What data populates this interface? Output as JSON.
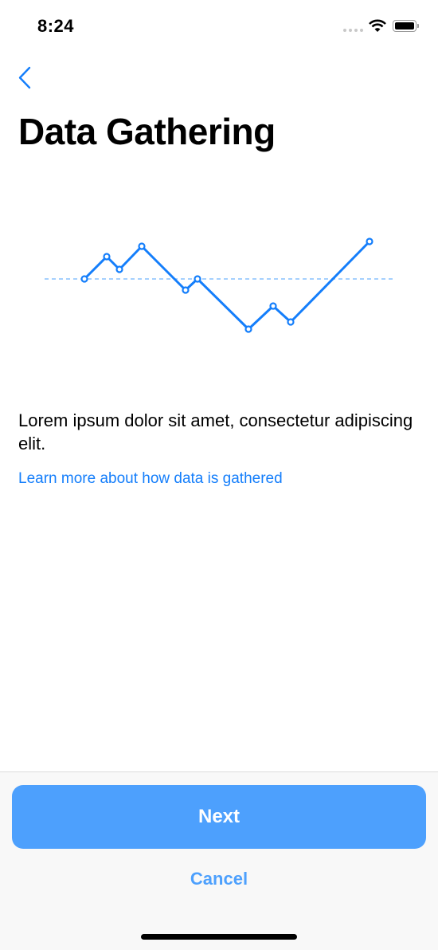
{
  "status_bar": {
    "time": "8:24"
  },
  "nav": {
    "back_icon": "chevron-left-icon"
  },
  "page": {
    "title": "Data Gathering",
    "body": "Lorem ipsum dolor sit amet, consectetur adipiscing elit.",
    "link": "Learn more about how data is gathered"
  },
  "chart_data": {
    "type": "line",
    "x": [
      50,
      78,
      94,
      122,
      177,
      192,
      256,
      287,
      309,
      408
    ],
    "values": [
      0,
      28,
      12,
      41,
      -14,
      0,
      -63,
      -34,
      -54,
      47
    ],
    "baseline": 0,
    "xlim": [
      0,
      439
    ],
    "ylim": [
      -70,
      50
    ],
    "color": "#147efb",
    "baseline_color": "#6fb3fd"
  },
  "footer": {
    "next_label": "Next",
    "cancel_label": "Cancel"
  },
  "colors": {
    "accent": "#147efb",
    "button": "#4da0fd",
    "footer_bg": "#f8f8f8"
  }
}
